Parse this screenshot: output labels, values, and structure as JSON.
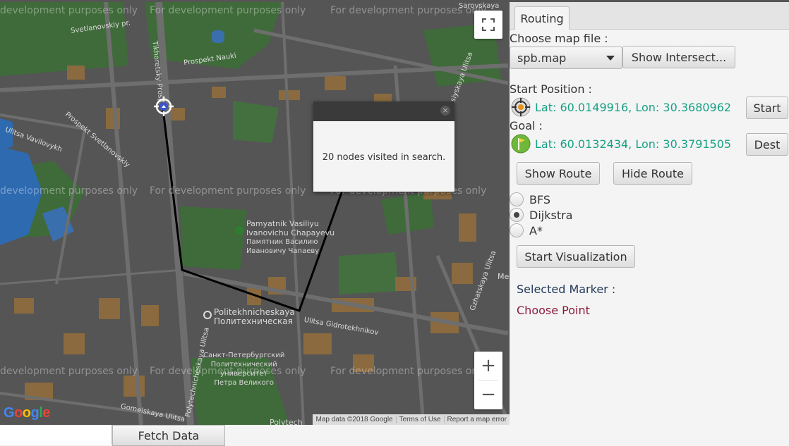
{
  "map": {
    "watermark": "For development purposes only",
    "watermark_clipped": "development purposes only",
    "streets": [
      "Svetlanovskiy pr.",
      "Prospekt Nauki",
      "Tikhoretsky Prosp.",
      "Ulitsa Vavilovykh",
      "Prospekt Svetlanovskiy",
      "Ulitsa Gidrotekhnikov",
      "Gzhatskaya Ulitsa",
      "Gzhatskaya Ulitsa",
      "Novorossiyskaya Ulitsa",
      "Gomelskaya Ulitsa",
      "Polytechnicheskaya Ulitsa"
    ],
    "pois": {
      "monument_en": "Pamyatnik Vasiliyu\nIvanovichu Chapayevu",
      "monument_ru": "Памятник Василию\nИвановичу Чапаеву",
      "metro_en": "Politekhnicheskaya",
      "metro_ru": "Политехническая",
      "univ_ru": "Санкт-Петербургский\nПолитехнический\nуниверситет\nПетра Великого",
      "bottom_label": "Polytech",
      "topright": "Sarovskaya",
      "right_m": "Me"
    },
    "popup_message": "20 nodes visited in search.",
    "attribution": [
      "Map data ©2018 Google",
      "Terms of Use",
      "Report a map error"
    ],
    "logo": "Google",
    "zoom_in": "+",
    "zoom_out": "−",
    "fullscreen_icon": "fullscreen-icon"
  },
  "bottom": {
    "fetch_label": "Fetch Data",
    "fetch_field_value": ""
  },
  "panel": {
    "tab_label": "Routing",
    "choose_map_label": "Choose map file :",
    "map_file_value": "spb.map",
    "show_intersections_label": "Show Intersect...",
    "start_position_label": "Start Position :",
    "start_coords": "Lat: 60.0149916, Lon: 30.3680962",
    "start_button": "Start",
    "goal_label": "Goal :",
    "goal_coords": "Lat: 60.0132434, Lon: 30.3791505",
    "dest_button": "Dest",
    "show_route_label": "Show Route",
    "hide_route_label": "Hide Route",
    "algorithms": [
      {
        "label": "BFS",
        "selected": false
      },
      {
        "label": "Dijkstra",
        "selected": true
      },
      {
        "label": "A*",
        "selected": false
      }
    ],
    "visualization_label": "Start Visualization",
    "selected_marker_label": "Selected Marker :",
    "choose_point_label": "Choose Point"
  },
  "colors": {
    "coord_text": "#17a085",
    "choose_point": "#8b1a3b",
    "selected_marker": "#23395b",
    "route_line": "#000000"
  }
}
